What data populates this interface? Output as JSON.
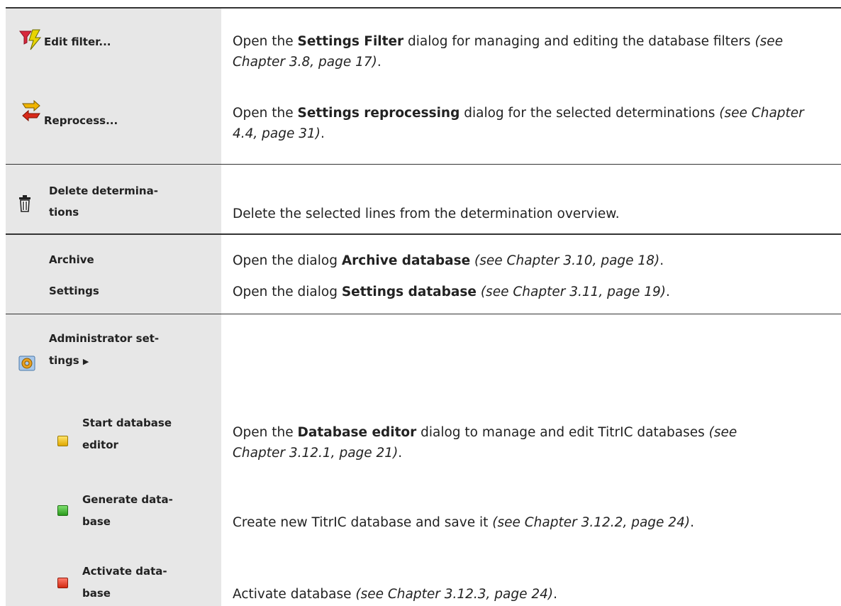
{
  "rows": {
    "edit_filter": {
      "icon": "filter-edit-icon",
      "label": "Edit filter...",
      "pre": "Open the ",
      "bold": "Settings Filter",
      "mid": " dialog for managing and editing the database filters ",
      "ref": "(see Chapter 3.8, page 17)",
      "post": "."
    },
    "reprocess": {
      "icon": "reprocess-icon",
      "label": "Reprocess...",
      "pre": "Open the ",
      "bold": "Settings reprocessing",
      "mid": " dialog for the selected determinations ",
      "ref": "(see Chapter 4.4, page 31)",
      "post": "."
    },
    "delete": {
      "icon": "trash-icon",
      "label_line1": "Delete determina-",
      "label_line2": "tions",
      "text": "Delete the selected lines from the determination overview."
    },
    "archive": {
      "label": "Archive",
      "pre": "Open the dialog ",
      "bold": "Archive database",
      "mid": " ",
      "ref": "(see Chapter 3.10, page 18)",
      "post": "."
    },
    "settings": {
      "label": "Settings",
      "pre": "Open the dialog ",
      "bold": "Settings database",
      "mid": " ",
      "ref": "(see Chapter 3.11, page 19)",
      "post": "."
    },
    "admin": {
      "icon": "admin-settings-icon",
      "label_line1": "Administrator set-",
      "label_line2": "tings",
      "arrow": "▶"
    },
    "start_editor": {
      "label_line1": "Start database",
      "label_line2": "editor",
      "pre": "Open the ",
      "bold": "Database editor",
      "mid": " dialog to manage and edit TitrIC databases ",
      "ref_line1": "(see",
      "ref_line2": "Chapter 3.12.1, page 21)",
      "post": "."
    },
    "generate": {
      "label_line1": "Generate data-",
      "label_line2": "base",
      "pre": "Create new TitrIC database and save it ",
      "ref": "(see Chapter 3.12.2, page 24)",
      "post": "."
    },
    "activate": {
      "label_line1": "Activate data-",
      "label_line2": "base",
      "pre": "Activate database ",
      "ref": "(see Chapter 3.12.3, page 24)",
      "post": "."
    }
  },
  "colors": {
    "left_column_bg": "#e7e7e7",
    "rule": "#333333",
    "text": "#222222"
  }
}
